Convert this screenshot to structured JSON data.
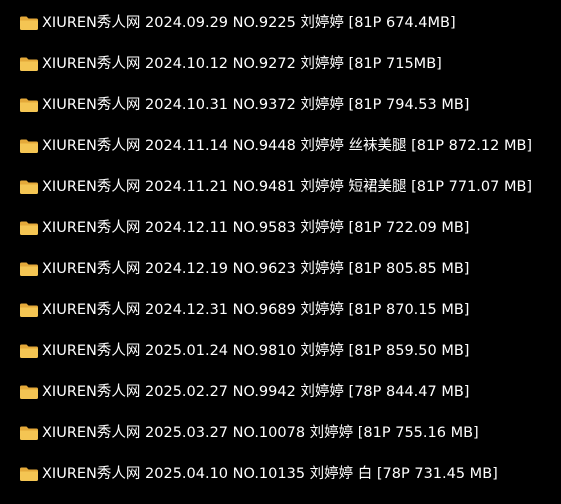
{
  "colors": {
    "background": "#000000",
    "text": "#ffffff",
    "folder_body": "#f4c553",
    "folder_tab": "#e4a93a"
  },
  "folders": [
    {
      "icon": "folder-icon",
      "name": "XIUREN秀人网 2024.09.29 NO.9225 刘婷婷 [81P 674.4MB]"
    },
    {
      "icon": "folder-icon",
      "name": "XIUREN秀人网 2024.10.12 NO.9272 刘婷婷 [81P 715MB]"
    },
    {
      "icon": "folder-icon",
      "name": "XIUREN秀人网 2024.10.31 NO.9372 刘婷婷 [81P 794.53 MB]"
    },
    {
      "icon": "folder-icon",
      "name": "XIUREN秀人网 2024.11.14 NO.9448 刘婷婷 丝袜美腿 [81P 872.12 MB]"
    },
    {
      "icon": "folder-icon",
      "name": "XIUREN秀人网 2024.11.21 NO.9481 刘婷婷 短裙美腿 [81P 771.07 MB]"
    },
    {
      "icon": "folder-icon",
      "name": "XIUREN秀人网 2024.12.11 NO.9583 刘婷婷 [81P 722.09 MB]"
    },
    {
      "icon": "folder-icon",
      "name": "XIUREN秀人网 2024.12.19 NO.9623 刘婷婷 [81P 805.85 MB]"
    },
    {
      "icon": "folder-icon",
      "name": "XIUREN秀人网 2024.12.31 NO.9689 刘婷婷 [81P 870.15 MB]"
    },
    {
      "icon": "folder-icon",
      "name": "XIUREN秀人网 2025.01.24 NO.9810 刘婷婷 [81P 859.50 MB]"
    },
    {
      "icon": "folder-icon",
      "name": "XIUREN秀人网 2025.02.27 NO.9942 刘婷婷 [78P 844.47 MB]"
    },
    {
      "icon": "folder-icon",
      "name": "XIUREN秀人网 2025.03.27 NO.10078 刘婷婷 [81P 755.16 MB]"
    },
    {
      "icon": "folder-icon",
      "name": "XIUREN秀人网 2025.04.10 NO.10135 刘婷婷 白 [78P 731.45 MB]"
    }
  ]
}
